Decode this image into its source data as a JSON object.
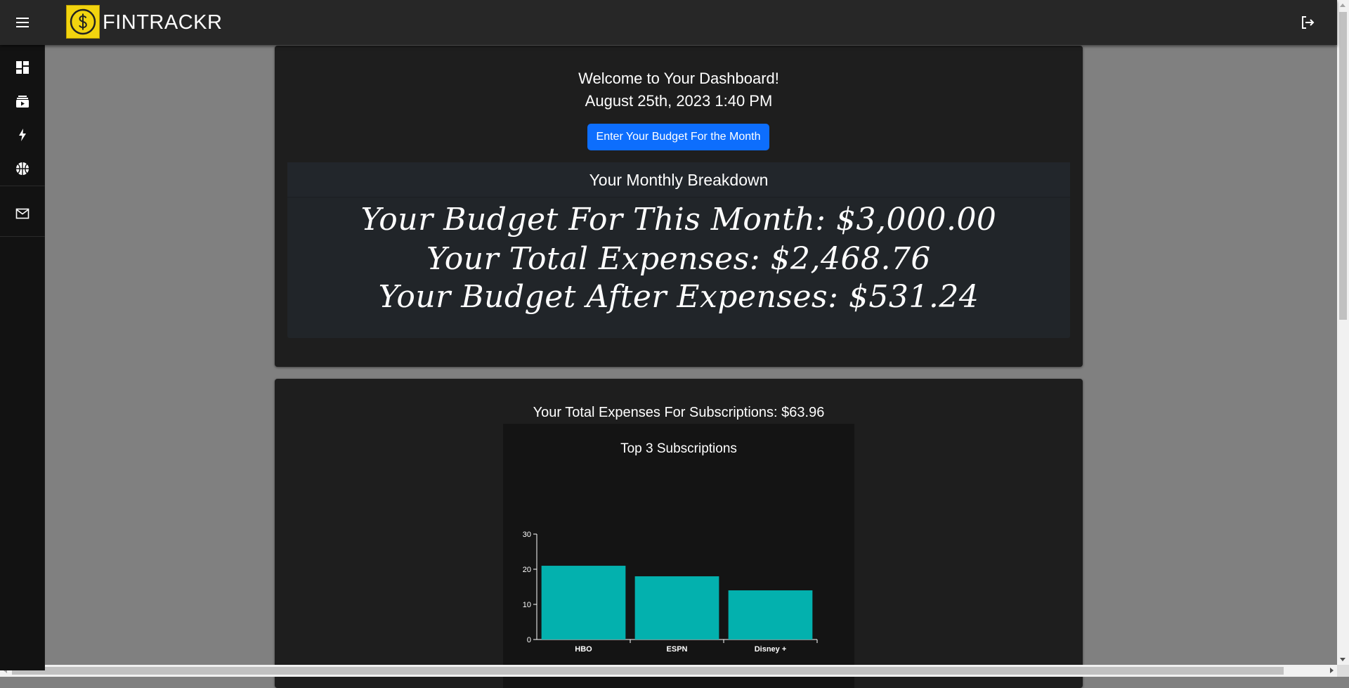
{
  "app": {
    "brand": "FINTRACKR"
  },
  "sidebar": {
    "items": [
      {
        "icon": "dashboard-icon"
      },
      {
        "icon": "subscriptions-icon"
      },
      {
        "icon": "bolt-icon"
      },
      {
        "icon": "sports-basketball-icon"
      },
      {
        "icon": "mail-icon"
      }
    ]
  },
  "dashboard": {
    "welcome": "Welcome to Your Dashboard!",
    "datetime": "August 25th, 2023 1:40 PM",
    "budget_button": "Enter Your Budget For the Month",
    "breakdown_title": "Your Monthly Breakdown",
    "budget_line": "Your Budget For This Month: $3,000.00",
    "expenses_line": "Your Total Expenses: $2,468.76",
    "after_line": "Your Budget After Expenses: $531.24"
  },
  "subscriptions": {
    "total_text": "Your Total Expenses For Subscriptions: $63.96",
    "chart_title": "Top 3 Subscriptions"
  },
  "colors": {
    "accent": "#0d6efd",
    "bar": "#03b1ae",
    "logo": "#f2d40f"
  },
  "chart_data": {
    "type": "bar",
    "title": "Top 3 Subscriptions",
    "categories": [
      "HBO",
      "ESPN",
      "Disney +"
    ],
    "values": [
      20.99,
      17.99,
      13.99
    ],
    "ylim": [
      0,
      30
    ],
    "yticks": [
      0,
      10,
      20,
      30
    ],
    "xlabel": "",
    "ylabel": "",
    "grid": false
  }
}
